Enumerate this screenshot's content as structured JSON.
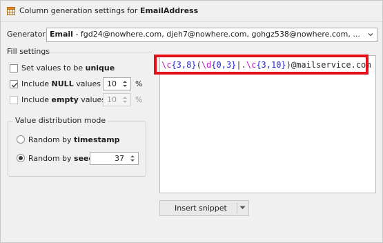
{
  "title": {
    "prefix": "Column generation settings for ",
    "column": "EmailAddress"
  },
  "generator": {
    "label": "Generator:",
    "name": "Email",
    "sample": " - fgd24@nowhere.com, djeh7@nowhere.com, gohgz538@nowhere.com, ..."
  },
  "fill_settings": {
    "label": "Fill settings",
    "unique": {
      "text": "Set values to be ",
      "bold": "unique",
      "checked": false
    },
    "null": {
      "text_before": "Include ",
      "bold": "NULL",
      "text_after": " values",
      "checked": true,
      "value": "10",
      "unit": "%"
    },
    "empty": {
      "text_before": "Include ",
      "bold": "empty",
      "text_after": " values",
      "checked": false,
      "value": "10",
      "unit": "%",
      "disabled": true
    }
  },
  "distribution": {
    "label": "Value distribution mode",
    "timestamp": {
      "text": "Random by ",
      "bold": "timestamp",
      "selected": false
    },
    "seed": {
      "text": "Random by ",
      "bold": "seed",
      "selected": true,
      "value": "37"
    }
  },
  "editor": {
    "tokens": [
      {
        "t": "\\c{3,8}",
        "c": "pink"
      },
      {
        "t": "(",
        "c": "dark"
      },
      {
        "t": "\\d{0,3}",
        "c": "pink"
      },
      {
        "t": "|",
        "c": "dark"
      },
      {
        "t": ".",
        "c": "dark"
      },
      {
        "t": "\\c{3,10}",
        "c": "pink"
      },
      {
        "t": ")",
        "c": "dark"
      },
      {
        "t": "@mailservice.com",
        "c": "dark"
      }
    ],
    "highlight_color": "#e3101a"
  },
  "snippet_button": {
    "label": "Insert snippet"
  },
  "icons": {
    "title": "table-grid-icon",
    "combo_arrow": "chevron-down-icon",
    "spin": "spin-up-down-icon",
    "dropdown": "caret-down-icon"
  },
  "colors": {
    "token_pink": "#c21cc4",
    "token_blue": "#2525d6",
    "token_dark": "#2b2b2b"
  }
}
